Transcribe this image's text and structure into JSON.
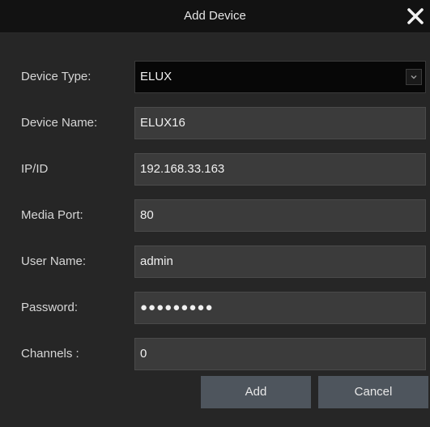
{
  "dialog": {
    "title": "Add Device",
    "close_icon": "close-icon"
  },
  "form": {
    "device_type": {
      "label": "Device Type:",
      "value": "ELUX",
      "dropdown_icon": "chevron-down-icon"
    },
    "device_name": {
      "label": "Device Name:",
      "value": "ELUX16"
    },
    "ip_id": {
      "label": "IP/ID",
      "value": "192.168.33.163"
    },
    "media_port": {
      "label": "Media Port:",
      "value": "80"
    },
    "user_name": {
      "label": "User Name:",
      "value": "admin"
    },
    "password": {
      "label": "Password:",
      "value": "●●●●●●●●●"
    },
    "channels": {
      "label": "Channels :",
      "value": "0"
    }
  },
  "buttons": {
    "add_label": "Add",
    "cancel_label": "Cancel"
  }
}
